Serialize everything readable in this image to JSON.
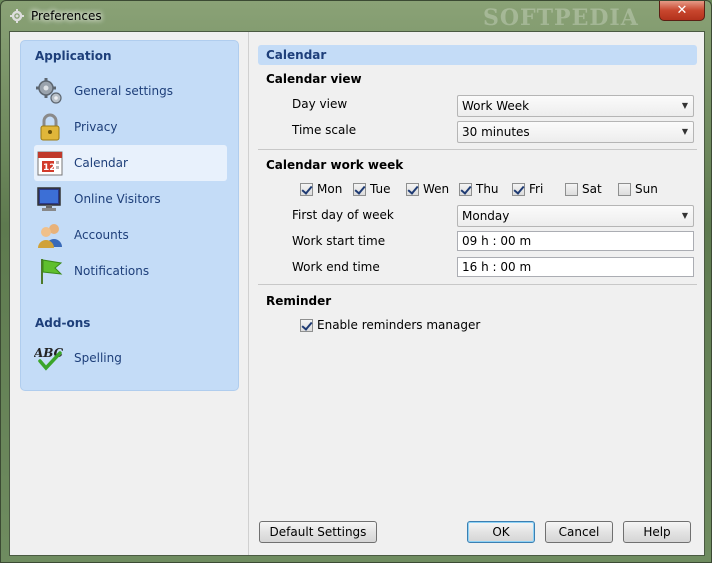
{
  "window": {
    "title": "Preferences",
    "close_glyph": "✕",
    "watermark": "SOFTPEDIA"
  },
  "sidebar": {
    "sections": [
      {
        "header": "Application",
        "items": [
          {
            "label": "General settings",
            "icon": "gears-icon"
          },
          {
            "label": "Privacy",
            "icon": "padlock-icon"
          },
          {
            "label": "Calendar",
            "icon": "calendar-icon",
            "selected": true
          },
          {
            "label": "Online Visitors",
            "icon": "monitor-icon"
          },
          {
            "label": "Accounts",
            "icon": "users-icon"
          },
          {
            "label": "Notifications",
            "icon": "flag-icon"
          }
        ]
      },
      {
        "header": "Add-ons",
        "items": [
          {
            "label": "Spelling",
            "icon": "spellcheck-icon"
          }
        ]
      }
    ],
    "calendar_icon_number": "12"
  },
  "main": {
    "section_title": "Calendar",
    "calendar_view": {
      "title": "Calendar view",
      "day_view_label": "Day view",
      "day_view_value": "Work Week",
      "time_scale_label": "Time scale",
      "time_scale_value": "30 minutes"
    },
    "work_week": {
      "title": "Calendar work week",
      "days": [
        {
          "label": "Mon",
          "checked": true
        },
        {
          "label": "Tue",
          "checked": true
        },
        {
          "label": "Wen",
          "checked": true
        },
        {
          "label": "Thu",
          "checked": true
        },
        {
          "label": "Fri",
          "checked": true
        },
        {
          "label": "Sat",
          "checked": false
        },
        {
          "label": "Sun",
          "checked": false
        }
      ],
      "first_day_label": "First day of week",
      "first_day_value": "Monday",
      "start_label": "Work start time",
      "start_value": "09 h : 00 m",
      "end_label": "Work end time",
      "end_value": "16 h : 00 m"
    },
    "reminder": {
      "title": "Reminder",
      "enable_label": "Enable reminders manager",
      "enable_checked": true
    }
  },
  "buttons": {
    "default_settings": "Default Settings",
    "ok": "OK",
    "cancel": "Cancel",
    "help": "Help"
  }
}
